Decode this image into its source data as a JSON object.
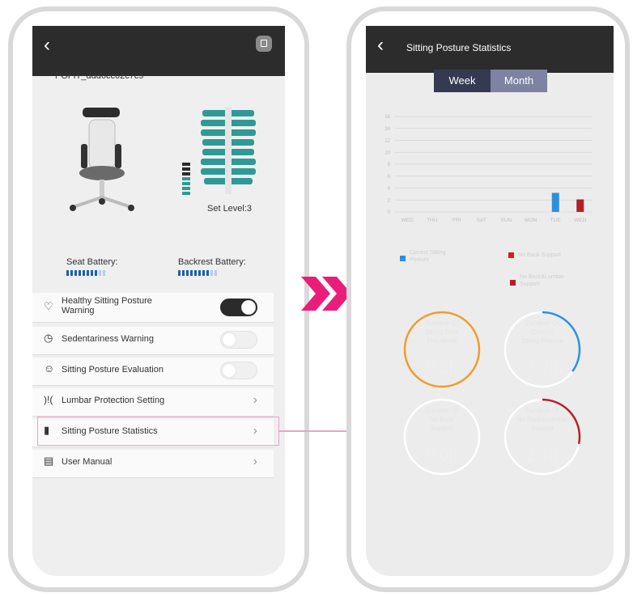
{
  "left_phone": {
    "device_name": "POFIT_ddd6cc02c7c9",
    "set_level": "Set Level:3",
    "seat_battery_label": "Seat Battery:",
    "backrest_battery_label": "Backrest Battery:",
    "menu": [
      {
        "label": "Healthy Sitting Posture",
        "label2": "Warning",
        "icon": "heart-icon",
        "control": "toggle",
        "state": "on"
      },
      {
        "label": "Sedentariness Warning",
        "icon": "clock-icon",
        "control": "toggle",
        "state": "off"
      },
      {
        "label": "Sitting Posture Evaluation",
        "icon": "smile-icon",
        "control": "toggle",
        "state": "off"
      },
      {
        "label": "Lumbar Protection Setting",
        "icon": "lumbar-icon",
        "control": "chevron"
      },
      {
        "label": "Sitting Posture Statistics",
        "icon": "bar-chart-icon",
        "control": "chevron"
      },
      {
        "label": "User Manual",
        "icon": "manual-icon",
        "control": "chevron"
      }
    ]
  },
  "right_phone": {
    "title": "Sitting Posture Statistics",
    "tabs": [
      "Week",
      "Month"
    ],
    "selected_tab": "Week",
    "legend": [
      {
        "label": "Correct Sitting",
        "label2": "Posture",
        "color": "#2d8fdf"
      },
      {
        "label": "No Back Support",
        "label2": "",
        "color": "#d11c2a"
      },
      {
        "label": "No Back&Lumbar",
        "label2": "Support",
        "color": "#b51f2a"
      }
    ],
    "rings": [
      {
        "l1": "Duration Of",
        "l2": "Sitting Time",
        "l3": "This Week",
        "value": "0.3h",
        "color": "#f29a2e",
        "fraction": 1.0
      },
      {
        "l1": "Duration Of",
        "l2": "Correct",
        "l3": "Sitting Posture",
        "value": "3.2h",
        "color": "#2d8fdf",
        "fraction": 0.35
      },
      {
        "l1": "Duration Of",
        "l2": "No Back",
        "l3": "Support",
        "value": "0.0h",
        "color": "#ffffff",
        "fraction": 0
      },
      {
        "l1": "Duration Of",
        "l2": "No Back&Lumbar",
        "l3": "Support",
        "value": "2.1h",
        "color": "#b51f2a",
        "fraction": 0.28
      }
    ]
  },
  "chart_data": {
    "type": "bar",
    "categories": [
      "WED",
      "THU",
      "FRI",
      "SAT",
      "SUN",
      "MON",
      "TUE",
      "WED"
    ],
    "y_ticks": [
      "16",
      "14",
      "12",
      "10",
      "8",
      "6",
      "4",
      "2",
      "0"
    ],
    "ylim": [
      0,
      16
    ],
    "series": [
      {
        "name": "Correct Sitting Posture",
        "color": "#2d8fdf",
        "values": [
          0,
          0,
          0,
          0,
          0,
          0,
          3.2,
          0
        ]
      },
      {
        "name": "No Back&Lumbar Support",
        "color": "#b51f2a",
        "values": [
          0,
          0,
          0,
          0,
          0,
          0,
          0,
          2.1
        ]
      }
    ]
  }
}
